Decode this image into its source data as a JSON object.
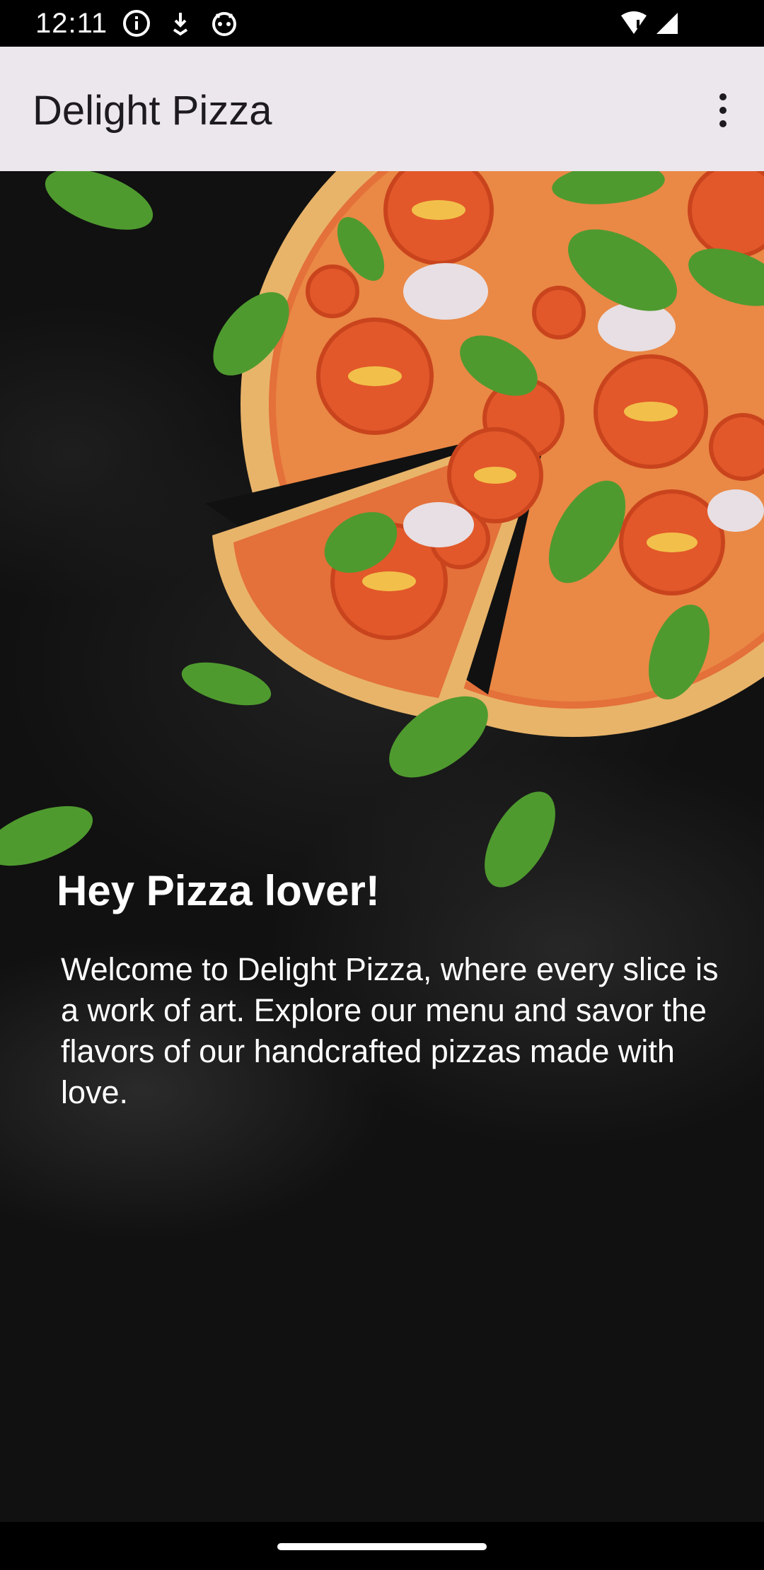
{
  "status_bar": {
    "time": "12:11",
    "icons_left": [
      "info-icon",
      "download-icon",
      "android-icon"
    ],
    "icons_right": [
      "wifi-icon",
      "signal-icon"
    ]
  },
  "app_bar": {
    "title": "Delight Pizza",
    "overflow_icon": "more-vert-icon",
    "background": "#ebe7ec"
  },
  "hero": {
    "headline": "Hey Pizza lover!",
    "welcome_text": "Welcome to Delight Pizza, where every slice is a work of art. Explore our menu and savor the flavors of our handcrafted pizzas made with love."
  },
  "colors": {
    "status_bar_bg": "#000000",
    "hero_bg": "#111111",
    "text_on_dark": "#ffffff",
    "crust": "#e8b46a",
    "tomato": "#e2582a",
    "basil": "#4f9a2f"
  }
}
